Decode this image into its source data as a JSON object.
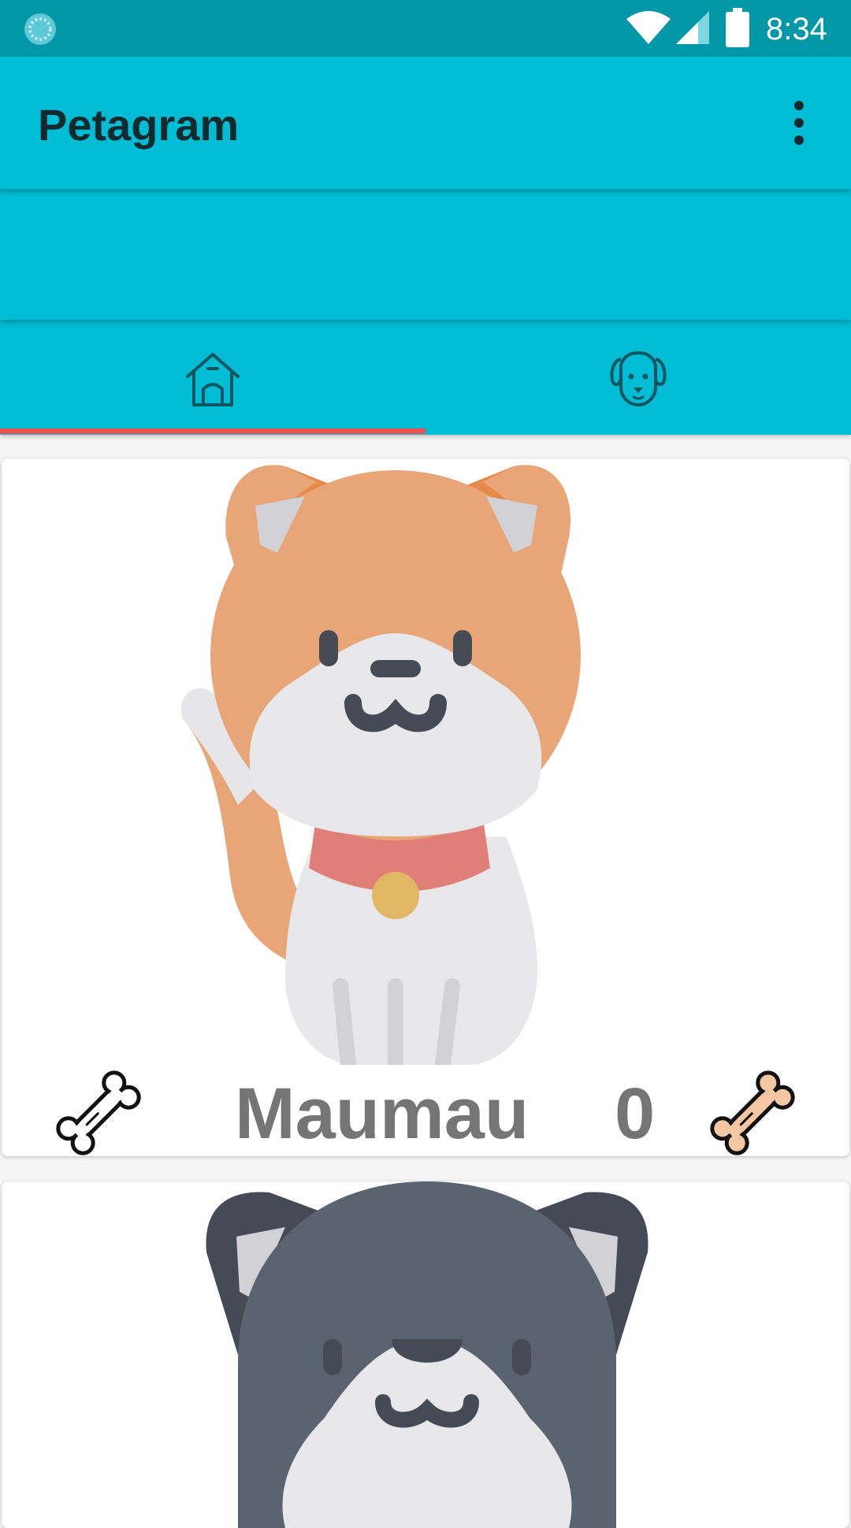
{
  "status_bar": {
    "time": "8:34",
    "icons": [
      "sync-icon",
      "wifi-icon",
      "cell-signal-icon",
      "battery-icon"
    ]
  },
  "app_bar": {
    "title": "Petagram",
    "overflow_icon": "more-vert-icon"
  },
  "tabs": [
    {
      "icon": "dog-house-icon",
      "selected": true
    },
    {
      "icon": "dog-face-icon",
      "selected": false
    }
  ],
  "colors": {
    "status_bar": "#0097a7",
    "primary": "#00bcd4",
    "tab_indicator": "#ef5350",
    "pet_text": "#757575"
  },
  "pets": [
    {
      "name": "Maumau",
      "likes": "0",
      "image_icon": "orange-cat-icon",
      "rate_icon": "bone-outline-icon",
      "likes_icon": "bone-filled-icon"
    },
    {
      "image_icon": "gray-cat-icon"
    }
  ]
}
